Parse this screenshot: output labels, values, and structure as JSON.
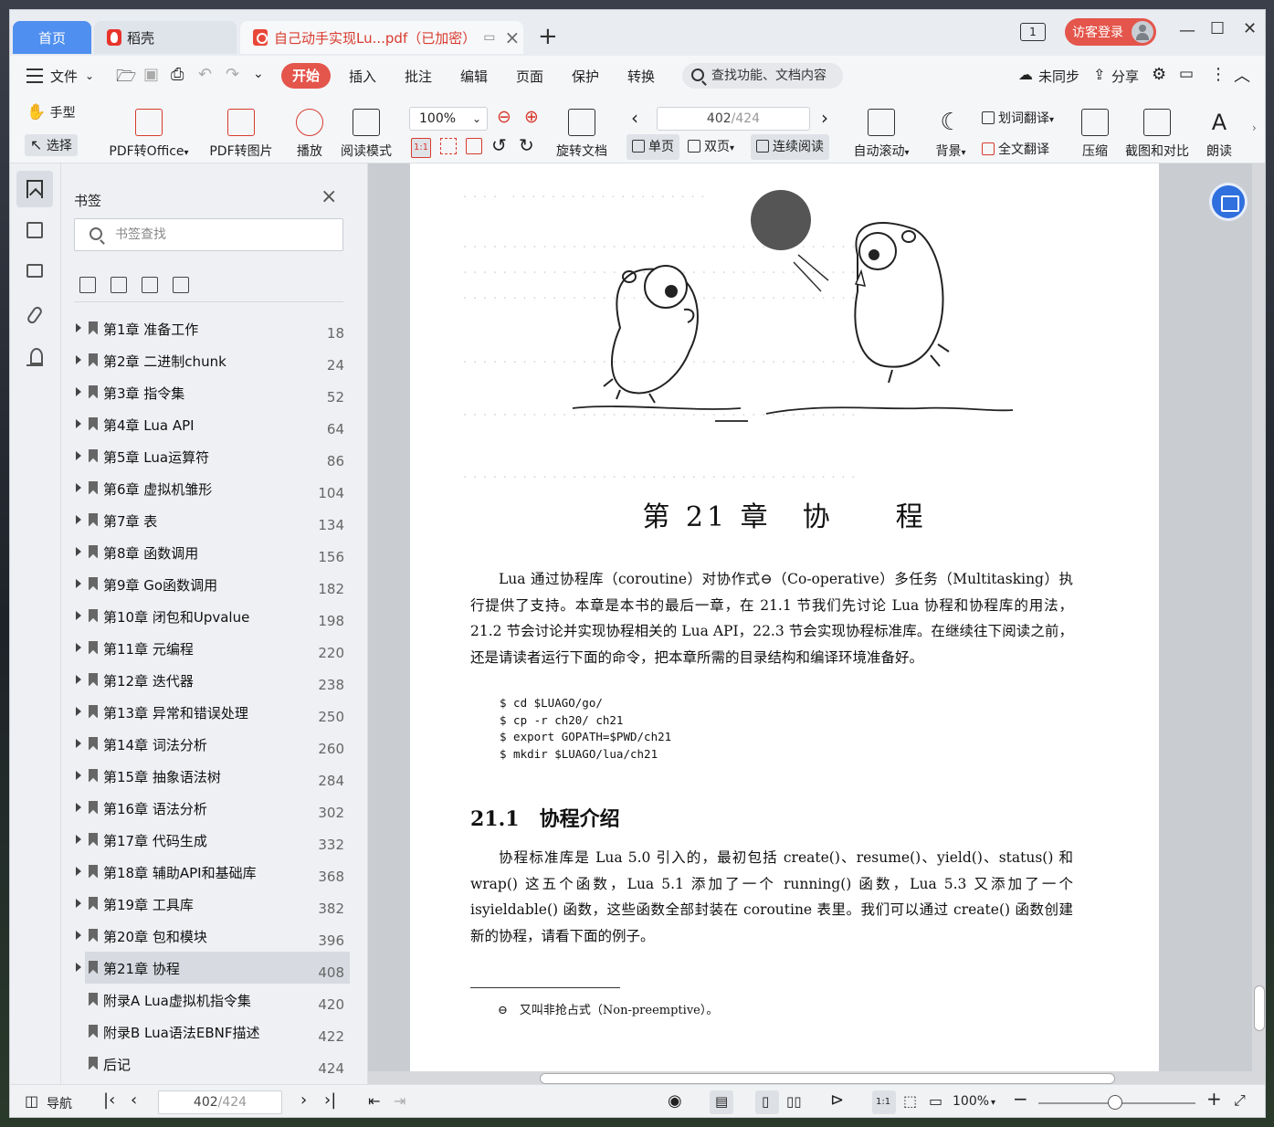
{
  "tabs": {
    "home": "首页",
    "daoke": "稻壳",
    "doc": "自己动手实现Lu...pdf（已加密）"
  },
  "titlebar": {
    "page_badge": "1",
    "login": "访客登录"
  },
  "menu": {
    "file": "文件",
    "start": "开始",
    "insert": "插入",
    "annotate": "批注",
    "edit": "编辑",
    "page": "页面",
    "protect": "保护",
    "convert": "转换",
    "search_placeholder": "查找功能、文档内容",
    "sync": "未同步",
    "share": "分享"
  },
  "toolbar": {
    "hand": "手型",
    "select": "选择",
    "pdf_to_office": "PDF转Office",
    "pdf_to_image": "PDF转图片",
    "play": "播放",
    "read_mode": "阅读模式",
    "zoom": "100%",
    "rotate": "旋转文档",
    "page_current": "402",
    "page_total": "/424",
    "single": "单页",
    "double": "双页",
    "continuous": "连续阅读",
    "auto_scroll": "自动滚动",
    "background": "背景",
    "word_translate": "划词翻译",
    "full_translate": "全文翻译",
    "compress": "压缩",
    "screenshot_compare": "截图和对比",
    "read_aloud": "朗读",
    "ratio_label": "1:1"
  },
  "panel": {
    "title": "书签",
    "search_placeholder": "书签查找",
    "bookmarks": [
      {
        "label": "第1章 准备工作",
        "page": "18"
      },
      {
        "label": "第2章 二进制chunk",
        "page": "24"
      },
      {
        "label": "第3章 指令集",
        "page": "52"
      },
      {
        "label": "第4章 Lua API",
        "page": "64"
      },
      {
        "label": "第5章 Lua运算符",
        "page": "86"
      },
      {
        "label": "第6章 虚拟机雏形",
        "page": "104"
      },
      {
        "label": "第7章 表",
        "page": "134"
      },
      {
        "label": "第8章 函数调用",
        "page": "156"
      },
      {
        "label": "第9章 Go函数调用",
        "page": "182"
      },
      {
        "label": "第10章 闭包和Upvalue",
        "page": "198"
      },
      {
        "label": "第11章 元编程",
        "page": "220"
      },
      {
        "label": "第12章 迭代器",
        "page": "238"
      },
      {
        "label": "第13章 异常和错误处理",
        "page": "250"
      },
      {
        "label": "第14章 词法分析",
        "page": "260"
      },
      {
        "label": "第15章 抽象语法树",
        "page": "284"
      },
      {
        "label": "第16章 语法分析",
        "page": "302"
      },
      {
        "label": "第17章 代码生成",
        "page": "332"
      },
      {
        "label": "第18章 辅助API和基础库",
        "page": "368"
      },
      {
        "label": "第19章 工具库",
        "page": "382"
      },
      {
        "label": "第20章 包和模块",
        "page": "396"
      },
      {
        "label": "第21章 协程",
        "page": "408"
      },
      {
        "label": "附录A Lua虚拟机指令集",
        "page": "420"
      },
      {
        "label": "附录B Lua语法EBNF描述",
        "page": "422"
      },
      {
        "label": "后记",
        "page": "424"
      }
    ]
  },
  "document": {
    "chapter_title": "第 21 章　协　　程",
    "intro": "Lua 通过协程库（coroutine）对协作式⊖（Co-operative）多任务（Multitasking）执行提供了支持。本章是本书的最后一章，在 21.1 节我们先讨论 Lua 协程和协程库的用法，21.2 节会讨论并实现协程相关的 Lua API，22.3 节会实现协程标准库。在继续往下阅读之前，还是请读者运行下面的命令，把本章所需的目录结构和编译环境准备好。",
    "code": [
      "$ cd $LUAGO/go/",
      "$ cp -r ch20/ ch21",
      "$ export GOPATH=$PWD/ch21",
      "$ mkdir $LUAGO/lua/ch21"
    ],
    "section_title": "21.1　协程介绍",
    "section_body": "协程标准库是 Lua 5.0 引入的，最初包括 create()、resume()、yield()、status() 和 wrap() 这五个函数，Lua 5.1 添加了一个 running() 函数，Lua 5.3 又添加了一个 isyieldable() 函数，这些函数全部封装在 coroutine 表里。我们可以通过 create() 函数创建新的协程，请看下面的例子。",
    "footnote": "⊖　又叫非抢占式（Non-preemptive）。"
  },
  "statusbar": {
    "nav": "导航",
    "page_current": "402",
    "page_total": "/424",
    "zoom": "100%",
    "ratio_label": "1:1"
  }
}
